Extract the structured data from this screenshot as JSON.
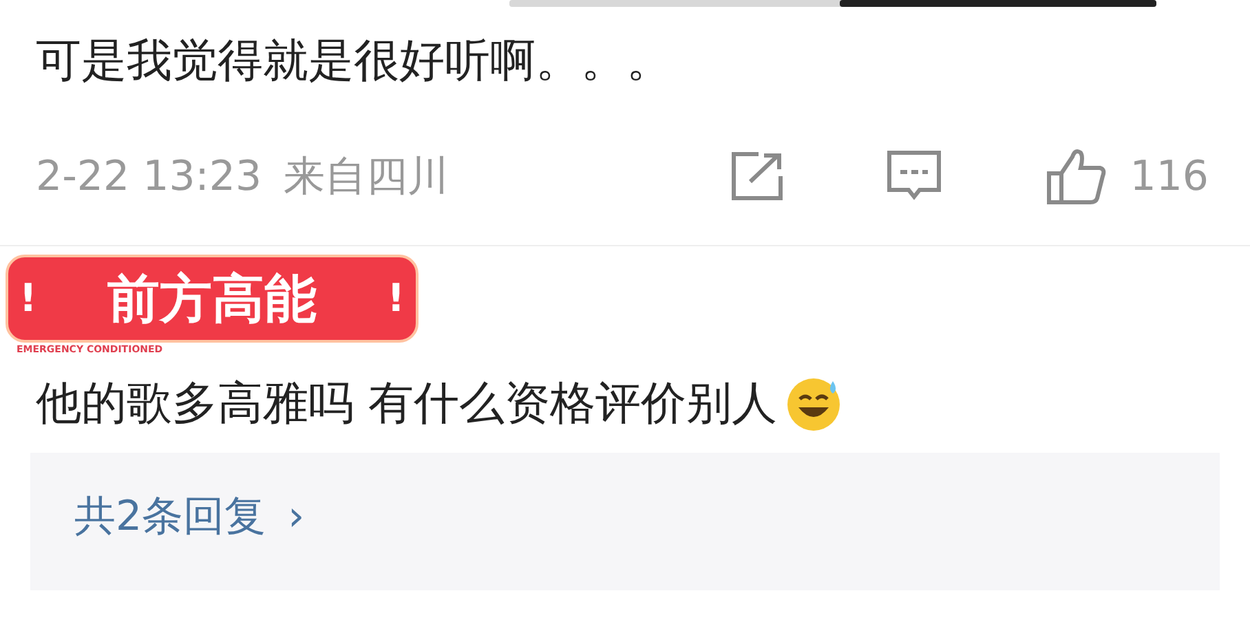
{
  "comments": [
    {
      "text": "可是我觉得就是很好听啊。。。",
      "time": "2-22 13:23",
      "location": "来自四川",
      "likes": "116"
    },
    {
      "sticker": {
        "mark_left": "!",
        "title": "前方高能",
        "mark_right": "!",
        "caption": "EMERGENCY CONDITIONED"
      },
      "text": "他的歌多高雅吗 有什么资格评价别人",
      "replies": {
        "label": "共2条回复",
        "chevron": "›"
      }
    }
  ]
}
